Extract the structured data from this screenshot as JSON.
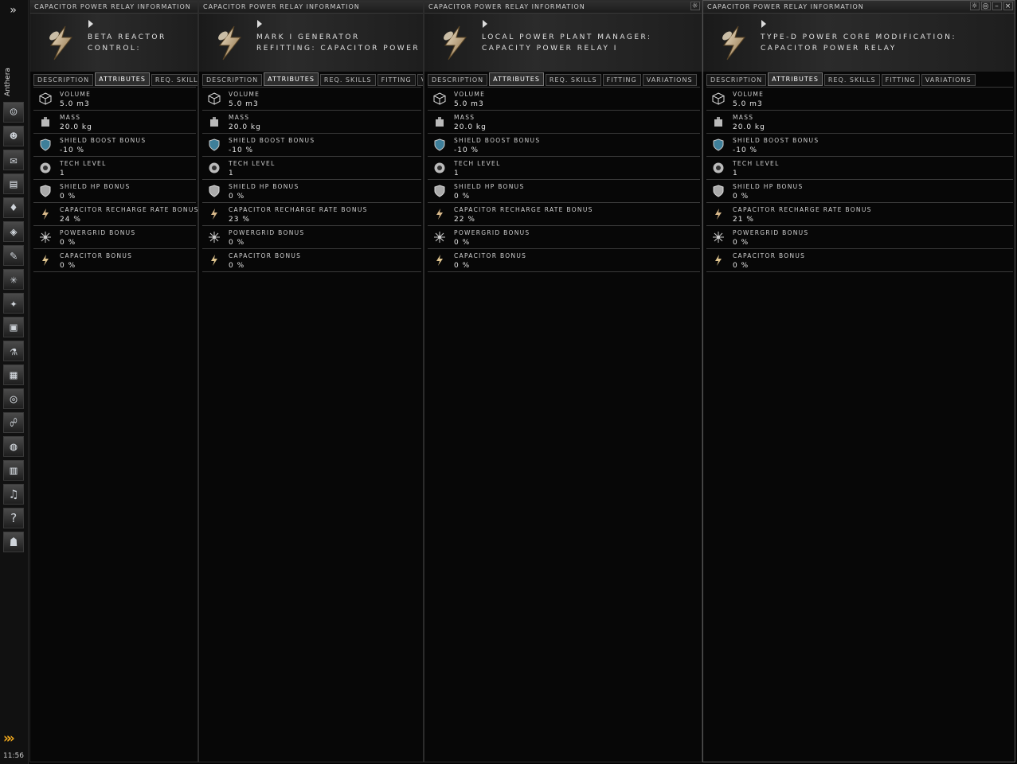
{
  "sidebar": {
    "character_name": "Anthera",
    "clock": "11:56",
    "icons": [
      "character-sheet-icon",
      "people-icon",
      "mail-icon",
      "notepad-icon",
      "market-icon",
      "corporation-icon",
      "journal-icon",
      "map-icon",
      "fitting-icon",
      "assets-icon",
      "science-icon",
      "calculator-icon",
      "help-lifebuoy-icon",
      "fleet-icon",
      "browser-icon",
      "wallet-icon",
      "audio-icon",
      "info-help-icon",
      "avatar-icon"
    ]
  },
  "attribute_labels": {
    "volume": "VOLUME",
    "mass": "MASS",
    "shield_boost": "SHIELD BOOST BONUS",
    "tech_level": "TECH LEVEL",
    "shield_hp": "SHIELD HP BONUS",
    "cap_recharge": "CAPACITOR RECHARGE RATE BONUS",
    "powergrid": "POWERGRID BONUS",
    "capacitor": "CAPACITOR BONUS"
  },
  "windows": [
    {
      "title": "CAPACITOR POWER RELAY INFORMATION",
      "item_name": "BETA REACTOR CONTROL: CAPACITOR POWER RELAY I",
      "tabs": [
        "DESCRIPTION",
        "ATTRIBUTES",
        "REQ. SKILLS"
      ],
      "values": {
        "volume": "5.0 m3",
        "mass": "20.0 kg",
        "shield_boost": "-10 %",
        "tech_level": "1",
        "shield_hp": "0 %",
        "cap_recharge": "24 %",
        "powergrid": "0 %",
        "capacitor": "0 %"
      }
    },
    {
      "title": "CAPACITOR POWER RELAY INFORMATION",
      "item_name": "MARK I GENERATOR REFITTING: CAPACITOR POWER RELAY",
      "tabs": [
        "DESCRIPTION",
        "ATTRIBUTES",
        "REQ. SKILLS",
        "FITTING",
        "VARIATIONS"
      ],
      "values": {
        "volume": "5.0 m3",
        "mass": "20.0 kg",
        "shield_boost": "-10 %",
        "tech_level": "1",
        "shield_hp": "0 %",
        "cap_recharge": "23 %",
        "powergrid": "0 %",
        "capacitor": "0 %"
      }
    },
    {
      "title": "CAPACITOR POWER RELAY INFORMATION",
      "item_name": "LOCAL POWER PLANT MANAGER: CAPACITY POWER RELAY I",
      "tabs": [
        "DESCRIPTION",
        "ATTRIBUTES",
        "REQ. SKILLS",
        "FITTING",
        "VARIATIONS"
      ],
      "values": {
        "volume": "5.0 m3",
        "mass": "20.0 kg",
        "shield_boost": "-10 %",
        "tech_level": "1",
        "shield_hp": "0 %",
        "cap_recharge": "22 %",
        "powergrid": "0 %",
        "capacitor": "0 %"
      }
    },
    {
      "title": "CAPACITOR POWER RELAY INFORMATION",
      "item_name": "TYPE-D POWER CORE MODIFICATION: CAPACITOR POWER RELAY",
      "tabs": [
        "DESCRIPTION",
        "ATTRIBUTES",
        "REQ. SKILLS",
        "FITTING",
        "VARIATIONS"
      ],
      "values": {
        "volume": "5.0 m3",
        "mass": "20.0 kg",
        "shield_boost": "-10 %",
        "tech_level": "1",
        "shield_hp": "0 %",
        "cap_recharge": "21 %",
        "powergrid": "0 %",
        "capacitor": "0 %"
      }
    }
  ]
}
